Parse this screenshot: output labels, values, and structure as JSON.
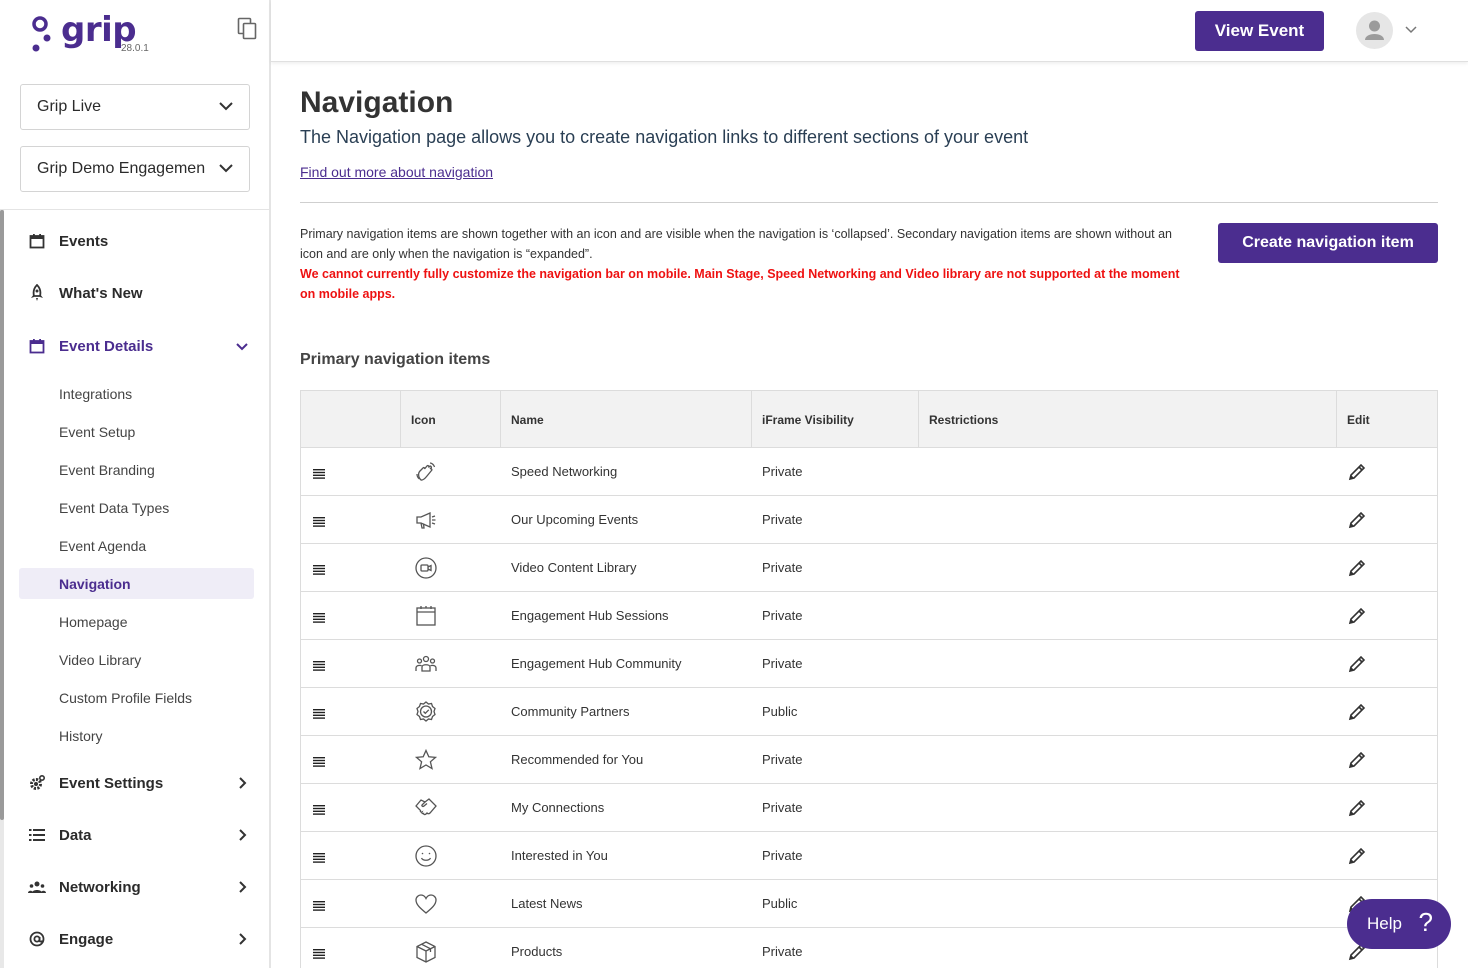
{
  "app": {
    "logo_text": "grip",
    "version": "28.0.1"
  },
  "sidebar": {
    "selects": [
      "Grip Live",
      "Grip Demo Engagemen"
    ],
    "items": [
      {
        "label": "Events",
        "icon": "calendar-icon"
      },
      {
        "label": "What's New",
        "icon": "rocket-icon"
      },
      {
        "label": "Event Details",
        "icon": "calendar-icon",
        "expanded": true,
        "active": true
      },
      {
        "label": "Event Settings",
        "icon": "gear-icon"
      },
      {
        "label": "Data",
        "icon": "list-icon"
      },
      {
        "label": "Networking",
        "icon": "people-icon"
      },
      {
        "label": "Engage",
        "icon": "at-icon"
      }
    ],
    "sub_items": [
      "Integrations",
      "Event Setup",
      "Event Branding",
      "Event Data Types",
      "Event Agenda",
      "Navigation",
      "Homepage",
      "Video Library",
      "Custom Profile Fields",
      "History"
    ],
    "active_sub_item": "Navigation"
  },
  "header": {
    "view_event_label": "View Event"
  },
  "page": {
    "title": "Navigation",
    "subtitle": "The Navigation page allows you to create navigation links to different sections of your event",
    "link": "Find out more about navigation",
    "info_text": "Primary navigation items are shown together with an icon and are visible when the navigation is ‘collapsed’. Secondary navigation items are shown without an icon and are only when the navigation is “expanded”.",
    "warning_text": "We cannot currently fully customize the navigation bar on mobile. Main Stage, Speed Networking and Video library are not supported at the moment on mobile apps.",
    "create_button": "Create navigation item",
    "section_title": "Primary navigation items"
  },
  "table": {
    "columns": [
      "",
      "Icon",
      "Name",
      "iFrame Visibility",
      "Restrictions",
      "Edit"
    ],
    "rows": [
      {
        "icon": "waving-hand-icon",
        "name": "Speed Networking",
        "visibility": "Private",
        "restrictions": ""
      },
      {
        "icon": "megaphone-icon",
        "name": "Our Upcoming Events",
        "visibility": "Private",
        "restrictions": ""
      },
      {
        "icon": "video-camera-icon",
        "name": "Video Content Library",
        "visibility": "Private",
        "restrictions": ""
      },
      {
        "icon": "calendar-icon",
        "name": "Engagement Hub Sessions",
        "visibility": "Private",
        "restrictions": ""
      },
      {
        "icon": "community-icon",
        "name": "Engagement Hub Community",
        "visibility": "Private",
        "restrictions": ""
      },
      {
        "icon": "badge-check-icon",
        "name": "Community Partners",
        "visibility": "Public",
        "restrictions": ""
      },
      {
        "icon": "star-icon",
        "name": "Recommended for You",
        "visibility": "Private",
        "restrictions": ""
      },
      {
        "icon": "handshake-icon",
        "name": "My Connections",
        "visibility": "Private",
        "restrictions": ""
      },
      {
        "icon": "smiley-icon",
        "name": "Interested in You",
        "visibility": "Private",
        "restrictions": ""
      },
      {
        "icon": "heart-icon",
        "name": "Latest News",
        "visibility": "Public",
        "restrictions": ""
      },
      {
        "icon": "box-icon",
        "name": "Products",
        "visibility": "Private",
        "restrictions": ""
      }
    ]
  },
  "help": {
    "label": "Help",
    "symbol": "?"
  },
  "colors": {
    "brand": "#4b2d8f",
    "warning": "#ee1111"
  }
}
